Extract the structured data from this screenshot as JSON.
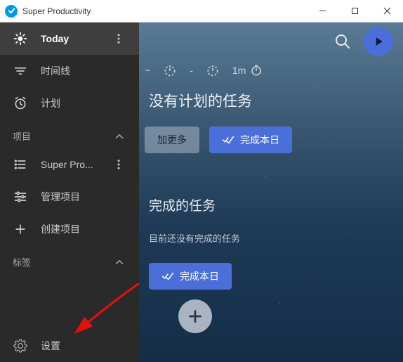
{
  "window": {
    "title": "Super Productivity"
  },
  "sidebar": {
    "today": "Today",
    "timeline": "时间线",
    "plan": "计划",
    "projects_header": "项目",
    "projects": {
      "item0": "Super Pro...",
      "manage": "管理项目",
      "create": "创建项目"
    },
    "tags_header": "标签",
    "settings": "设置"
  },
  "main": {
    "stats": {
      "dash": "~",
      "duration": "1m"
    },
    "no_plan_heading": "没有计划的任务",
    "add_more": "加更多",
    "finish_today": "完成本日",
    "done_heading": "完成的任务",
    "done_empty": "目前还没有完成的任务"
  }
}
